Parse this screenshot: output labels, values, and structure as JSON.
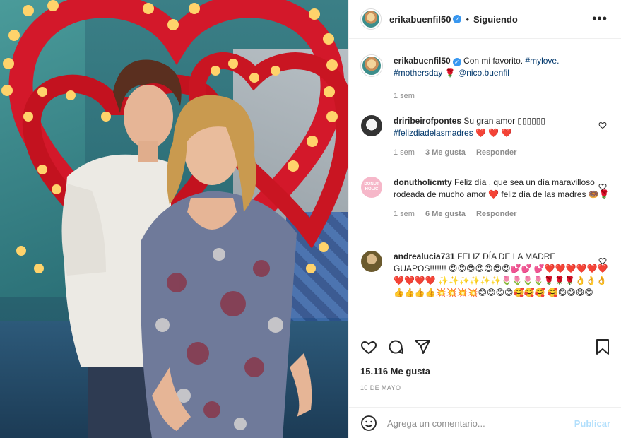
{
  "post": {
    "author": "erikabuenfil50",
    "follow_status": "Siguiendo",
    "more_icon": "more-options-icon",
    "caption": {
      "text": "Con mi favorito.",
      "hashtags": [
        "#mylove.",
        "#mothersday"
      ],
      "mention": "@nico.buenfil",
      "emoji": "🌹",
      "time": "1 sem"
    },
    "likes": "15.116 Me gusta",
    "date": "10 DE MAYO",
    "comment_placeholder": "Agrega un comentario...",
    "publish_label": "Publicar"
  },
  "comments": [
    {
      "user": "driribeirofpontes",
      "text": "Su gran amor ▯▯▯▯▯▯",
      "hashtag": "#felizdiadelasmadres",
      "emojis": "❤️ ❤️ ❤️",
      "time": "1 sem",
      "likes": "3 Me gusta",
      "reply": "Responder"
    },
    {
      "user": "donutholicmty",
      "avatar_text": "DONUT HOLIC",
      "text": "Feliz día , que sea un día maravilloso rodeada de mucho amor",
      "text2": "feliz día de las madres",
      "emojis": "❤️",
      "emojis2": "🍩🌹",
      "time": "1 sem",
      "likes": "6 Me gusta",
      "reply": "Responder"
    },
    {
      "user": "andrealucia731",
      "text": "FELIZ DÍA DE LA MADRE GUAPOS!!!!!!!",
      "emoji_line1": "😍😍😍😍😍😍😍💕💕",
      "emoji_line2": "💕❤️❤️❤️❤️❤️❤️❤️❤️❤️❤️",
      "emoji_line3": "✨✨✨✨✨✨🌷🌷🌷🌷🌹🌹🌹👌👌👌",
      "emoji_line4": "👍👍👍👍💥💥💥💥😊😊😊😊🥰🥰🥰",
      "emoji_line5": "🥰😋😋😋😋"
    }
  ],
  "colors": {
    "link": "#00376b",
    "verified": "#3897f0",
    "muted": "#8e8e8e",
    "publish_disabled": "#b2dffc"
  },
  "icons": [
    "heart-icon",
    "comment-icon",
    "share-icon",
    "bookmark-icon",
    "emoji-icon",
    "verified-badge-icon"
  ]
}
